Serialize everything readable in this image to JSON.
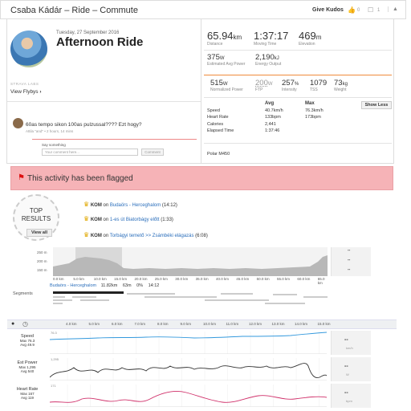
{
  "header": {
    "title": "Csaba Kádár – Ride – Commute",
    "give_kudos": "Give Kudos",
    "kudos_count": "0",
    "comment_count": "1"
  },
  "activity": {
    "date": "Tuesday, 27 September 2016",
    "name": "Afternoon Ride",
    "strava_labs": "STRAVA LABS",
    "view_flybys": "View Flybys"
  },
  "comment": {
    "text": "60as tempo sikon 100as pulzussal???? Ezt hogy?",
    "meta": "Attila \"and\" • 2 hours, 14 mins",
    "say_label": "Say something",
    "input_placeholder": "Your comment here...",
    "button": "Comment"
  },
  "stats": {
    "distance": {
      "value": "65.94",
      "unit": "km",
      "label": "Distance"
    },
    "moving_time": {
      "value": "1:37:17",
      "label": "Moving Time"
    },
    "elevation": {
      "value": "469",
      "unit": "m",
      "label": "Elevation"
    },
    "est_avg_power": {
      "value": "375",
      "unit": "W",
      "label": "Estimated Avg Power"
    },
    "energy": {
      "value": "2,190",
      "unit": "kJ",
      "label": "Energy Output"
    },
    "normalized_power": {
      "value": "515",
      "unit": "W",
      "label": "Normalized Power"
    },
    "ftp": {
      "value": "200",
      "unit": "W",
      "label": "FTP"
    },
    "intensity": {
      "value": "257",
      "unit": "%",
      "label": "Intensity"
    },
    "tss": {
      "value": "1079",
      "label": "TSS"
    },
    "weight": {
      "value": "73",
      "unit": "kg",
      "label": "Weight"
    }
  },
  "table": {
    "col_avg": "Avg",
    "col_max": "Max",
    "rows": [
      {
        "label": "Speed",
        "avg": "40.7km/h",
        "max": "76.3km/h"
      },
      {
        "label": "Heart Rate",
        "avg": "133bpm",
        "max": "173bpm"
      },
      {
        "label": "Calories",
        "avg": "2,441",
        "max": ""
      },
      {
        "label": "Elapsed Time",
        "avg": "1:37:46",
        "max": ""
      }
    ],
    "show_less": "Show Less",
    "device": "Polar M450"
  },
  "flag": {
    "text": "This activity has been flagged"
  },
  "top_results": {
    "line1": "TOP",
    "line2": "RESULTS",
    "view_all": "View all",
    "items": [
      {
        "kom": "KOM",
        "on": "on",
        "segment": "Budaörs - Herceghalom",
        "time": "(14:12)"
      },
      {
        "kom": "KOM",
        "on": "on",
        "segment": "1-es út Biatorbágy előtt",
        "time": "(1:33)"
      },
      {
        "kom": "KOM",
        "on": "on",
        "segment": "Torbágyi temető >> Zsámbéki elágazás",
        "time": "(6:08)"
      }
    ]
  },
  "elevation_chart": {
    "y_labels": [
      "250 m",
      "200 m",
      "150 m"
    ],
    "x_labels": [
      "0.0 km",
      "5.0 km",
      "10.0 km",
      "15.0 km",
      "20.0 km",
      "25.0 km",
      "30.0 km",
      "35.0 km",
      "40.0 km",
      "45.0 km",
      "50.0 km",
      "55.0 km",
      "60.0 km",
      "65.0 km"
    ],
    "side_dash": [
      "--",
      "--",
      "--"
    ]
  },
  "segments": {
    "label": "Segments",
    "selected_name": "Budaörs - Herceghalom",
    "selected_dist": "11.82km",
    "selected_elev": "63m",
    "selected_grade": "0%",
    "selected_time": "14:12"
  },
  "analysis": {
    "x_labels": [
      "4.0 km",
      "5.0 km",
      "6.0 km",
      "7.0 km",
      "8.0 km",
      "9.0 km",
      "10.0 km",
      "11.0 km",
      "12.0 km",
      "13.0 km",
      "14.0 km",
      "15.0 km"
    ],
    "streams": [
      {
        "name": "Speed",
        "max": "Max 76.3",
        "avg": "Avg 49.9",
        "top_tick": "76.3",
        "value": "--",
        "unit": "km/h",
        "color": "#3399dd"
      },
      {
        "name": "Est Power",
        "max": "Max 1,295",
        "avg": "Avg 540",
        "top_tick": "1,295",
        "value": "--",
        "unit": "W",
        "color": "#333333"
      },
      {
        "name": "Heart Rate",
        "max": "Max 167",
        "avg": "Avg 119",
        "top_tick": "171",
        "value": "--",
        "unit": "bpm",
        "color": "#d0306a"
      }
    ]
  }
}
